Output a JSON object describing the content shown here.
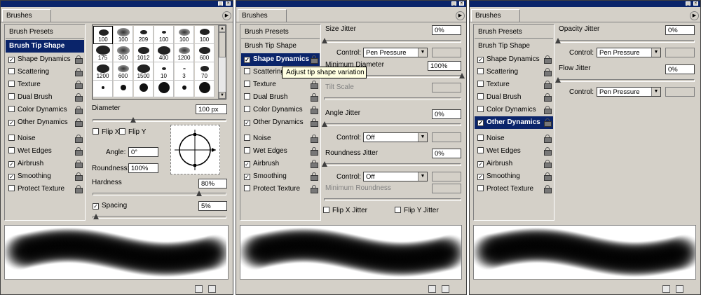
{
  "panel_title": "Brushes",
  "sidebar": {
    "presets": "Brush Presets",
    "tip_shape": "Brush Tip Shape",
    "items": [
      {
        "label": "Shape Dynamics",
        "checked": true
      },
      {
        "label": "Scattering",
        "checked": false
      },
      {
        "label": "Texture",
        "checked": false
      },
      {
        "label": "Dual Brush",
        "checked": false
      },
      {
        "label": "Color Dynamics",
        "checked": false
      },
      {
        "label": "Other Dynamics",
        "checked": true
      },
      {
        "label": "Noise",
        "checked": false
      },
      {
        "label": "Wet Edges",
        "checked": false
      },
      {
        "label": "Airbrush",
        "checked": true
      },
      {
        "label": "Smoothing",
        "checked": true
      },
      {
        "label": "Protect Texture",
        "checked": false
      }
    ]
  },
  "panel1": {
    "thumbnails": [
      "100",
      "100",
      "209",
      "100",
      "100",
      "100",
      "175",
      "300",
      "1012",
      "400",
      "1200",
      "600",
      "1200",
      "600",
      "1500",
      "10",
      "3",
      "70"
    ],
    "diameter_label": "Diameter",
    "diameter_value": "100 px",
    "diameter_level": 0.3,
    "flip_x": "Flip X",
    "flip_y": "Flip Y",
    "angle_label": "Angle:",
    "angle_value": "0°",
    "roundness_label": "Roundness:",
    "roundness_value": "100%",
    "hardness_label": "Hardness",
    "hardness_value": "80%",
    "hardness_level": 0.8,
    "spacing_label": "Spacing",
    "spacing_value": "5%",
    "spacing_level": 0.02
  },
  "panel2": {
    "size_jitter_label": "Size Jitter",
    "size_jitter_value": "0%",
    "control_label": "Control:",
    "size_control": "Pen Pressure",
    "min_diameter_label": "Minimum Diameter",
    "min_diameter_value": "100%",
    "tilt_scale_label": "Tilt Scale",
    "angle_jitter_label": "Angle Jitter",
    "angle_jitter_value": "0%",
    "angle_control": "Off",
    "roundness_jitter_label": "Roundness Jitter",
    "roundness_jitter_value": "0%",
    "roundness_control": "Off",
    "min_roundness_label": "Minimum Roundness",
    "flip_x_jitter": "Flip X Jitter",
    "flip_y_jitter": "Flip Y Jitter",
    "tooltip": "Adjust tip shape variation"
  },
  "panel3": {
    "opacity_jitter_label": "Opacity Jitter",
    "opacity_jitter_value": "0%",
    "control_label": "Control:",
    "opacity_control": "Pen Pressure",
    "flow_jitter_label": "Flow Jitter",
    "flow_jitter_value": "0%",
    "flow_control": "Pen Pressure"
  },
  "colors": {
    "selection": "#0a246a",
    "panel_bg": "#d4d0c8"
  }
}
